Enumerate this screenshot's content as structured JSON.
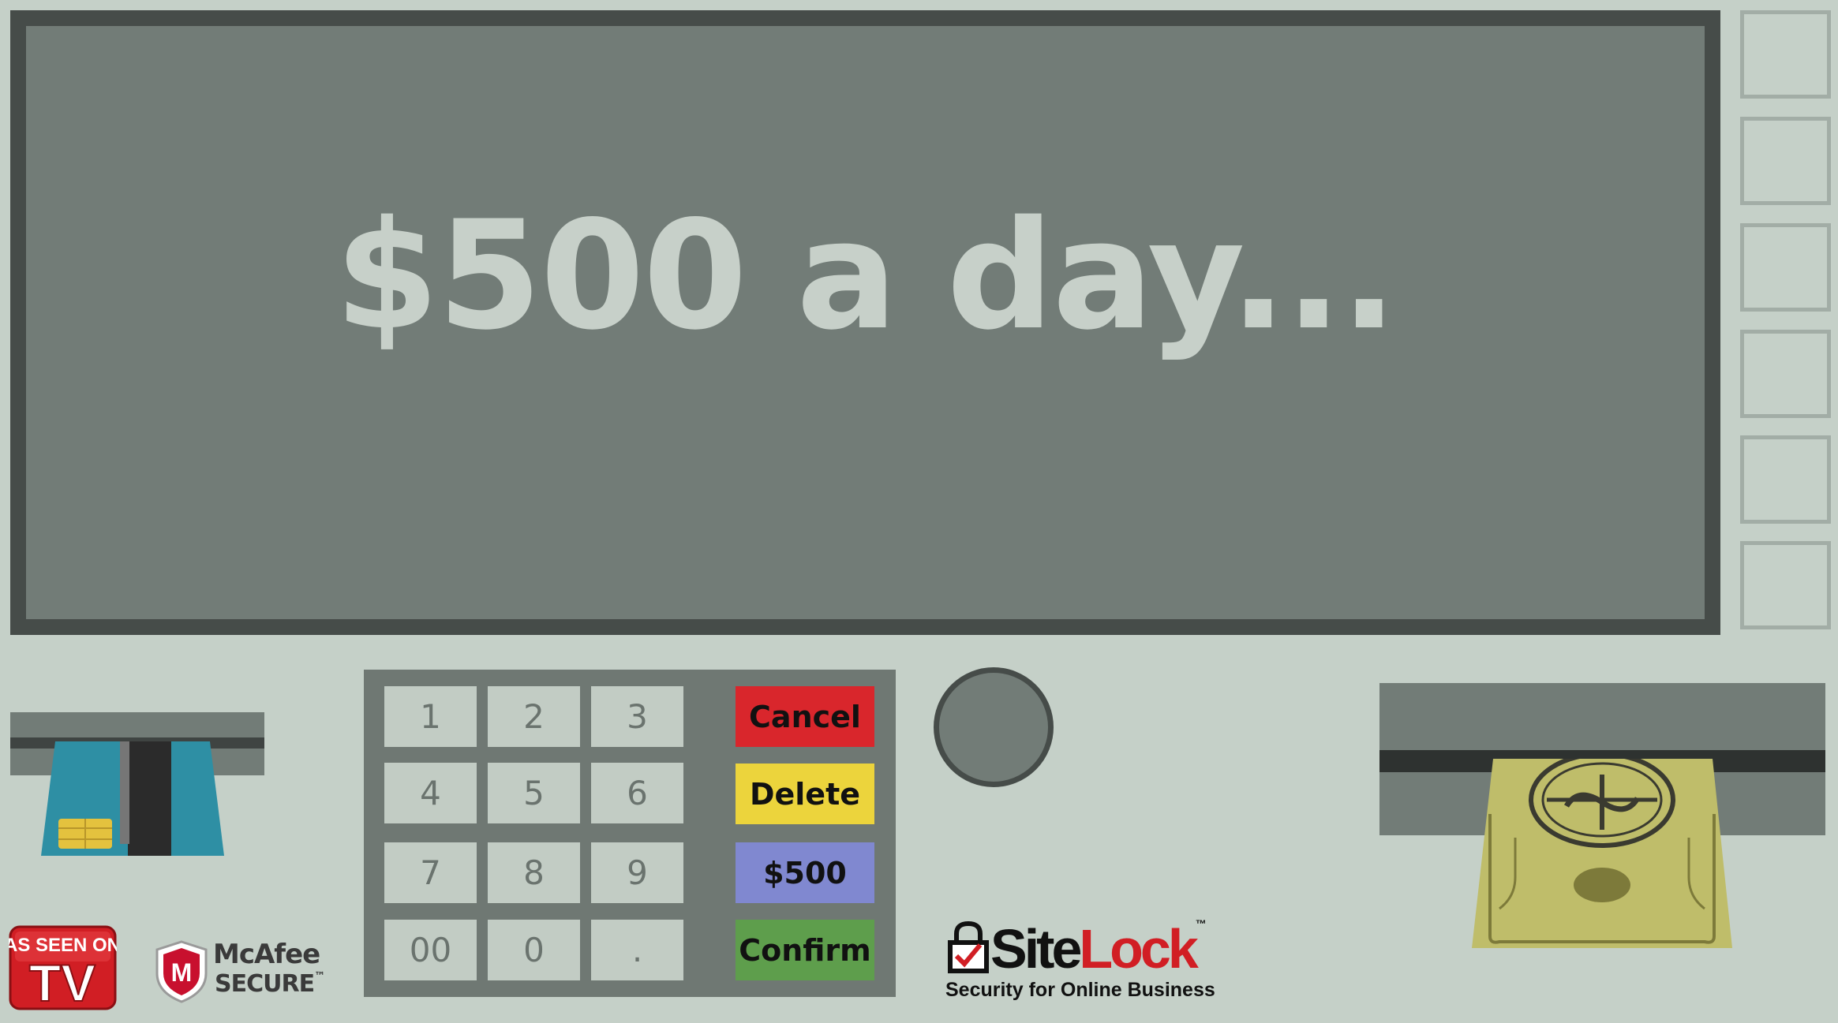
{
  "screen": {
    "message": "$500 a day..."
  },
  "keypad": {
    "keys": [
      "1",
      "2",
      "3",
      "4",
      "5",
      "6",
      "7",
      "8",
      "9",
      "00",
      "0",
      "."
    ],
    "cancel_label": "Cancel",
    "delete_label": "Delete",
    "amount_label": "$500",
    "confirm_label": "Confirm"
  },
  "colors": {
    "cancel": "#d9262c",
    "delete": "#ecd43c",
    "amount": "#8088d0",
    "confirm": "#5e9e4c",
    "background": "#c5d0c8",
    "screen": "#727c77"
  },
  "badges": {
    "tv": {
      "line1": "AS SEEN ON",
      "line2": "TV"
    },
    "mcafee": {
      "name": "McAfee",
      "secure": "SECURE",
      "tm": "™"
    },
    "sitelock": {
      "site": "Site",
      "lock": "Lock",
      "tm": "™",
      "tagline": "Security for Online Business"
    }
  },
  "icons": {
    "card": "credit-card-icon",
    "bill": "dollar-bill-icon",
    "lock": "padlock-icon",
    "shield": "mcafee-shield-icon"
  }
}
